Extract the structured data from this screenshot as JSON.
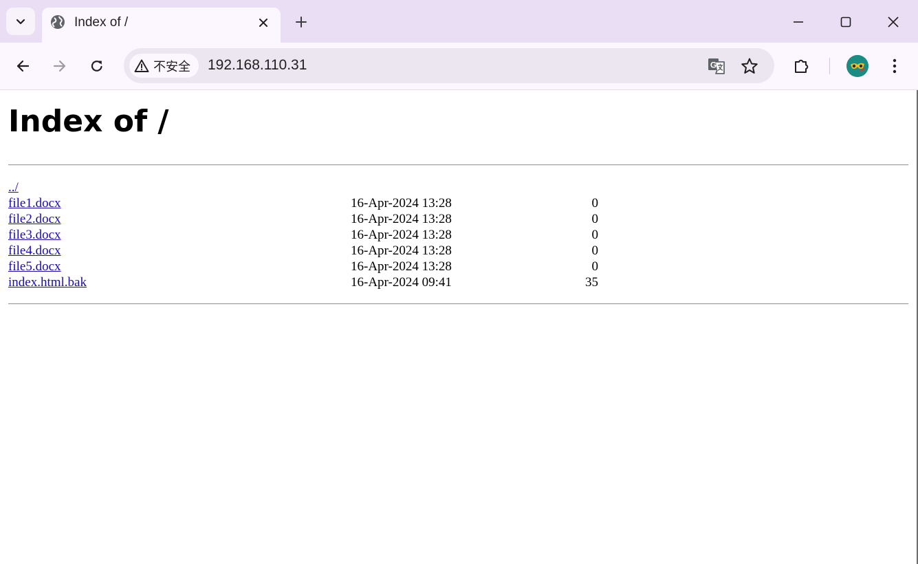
{
  "tab": {
    "title": "Index of /"
  },
  "toolbar": {
    "security_label": "不安全",
    "url": "192.168.110.31"
  },
  "page": {
    "title": "Index of /",
    "parent_link": "../",
    "files": [
      {
        "name": "file1.docx",
        "date": "16-Apr-2024 13:28",
        "size": "0"
      },
      {
        "name": "file2.docx",
        "date": "16-Apr-2024 13:28",
        "size": "0"
      },
      {
        "name": "file3.docx",
        "date": "16-Apr-2024 13:28",
        "size": "0"
      },
      {
        "name": "file4.docx",
        "date": "16-Apr-2024 13:28",
        "size": "0"
      },
      {
        "name": "file5.docx",
        "date": "16-Apr-2024 13:28",
        "size": "0"
      },
      {
        "name": "index.html.bak",
        "date": "16-Apr-2024 09:41",
        "size": "35"
      }
    ]
  },
  "colors": {
    "tabstrip_bg": "#e9def3",
    "toolbar_bg": "#fcf7fe",
    "omnibox_bg": "#ece6f0",
    "link": "#1a0dab"
  },
  "icons": {
    "tab_search": "chevron-down-icon",
    "favicon": "globe-icon",
    "tab_close": "close-icon",
    "new_tab": "plus-icon",
    "minimize": "minimize-icon",
    "maximize": "maximize-icon",
    "window_close": "close-icon",
    "back": "arrow-left-icon",
    "forward": "arrow-right-icon",
    "reload": "reload-icon",
    "security": "warning-icon",
    "translate": "translate-icon",
    "bookmark": "star-icon",
    "extensions": "puzzle-icon",
    "profile": "avatar",
    "menu": "kebab-menu-icon"
  }
}
